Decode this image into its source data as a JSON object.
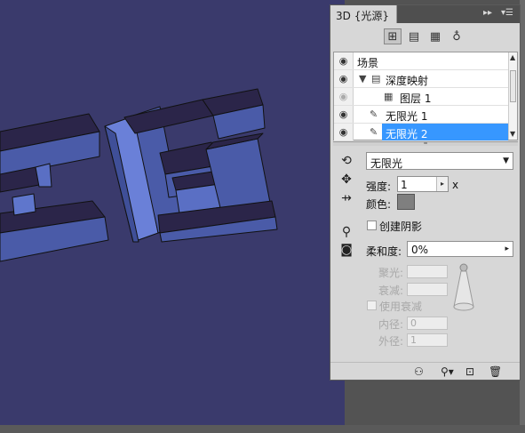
{
  "panel": {
    "tab_title": "3D {光源}",
    "expand_icon": "double-arrow-right-icon",
    "menu_icon": "panel-menu-icon"
  },
  "filters": {
    "icons": [
      "scene-filter-icon",
      "mesh-filter-icon",
      "material-filter-icon",
      "light-filter-icon"
    ]
  },
  "scene": {
    "rows": [
      {
        "label": "场景",
        "icon": "",
        "visible": true
      },
      {
        "label": "深度映射",
        "icon": "mesh-icon",
        "visible": true
      },
      {
        "label": "图层 1",
        "icon": "material-icon",
        "visible": false
      },
      {
        "label": "无限光 1",
        "icon": "infinite-light-icon",
        "visible": true
      },
      {
        "label": "无限光 2",
        "icon": "infinite-light-icon",
        "visible": true,
        "selected": true
      }
    ]
  },
  "properties": {
    "light_type": "无限光",
    "intensity_label": "强度:",
    "intensity_value": "1",
    "intensity_suffix": "x",
    "color_label": "颜色:",
    "color_value": "#7f7f7f",
    "shadow_label": "创建阴影",
    "softness_label": "柔和度:",
    "softness_value": "0%",
    "hotspot_label": "聚光:",
    "falloff_label": "衰减:",
    "use_attenuation_label": "使用衰减",
    "inner_label": "内径:",
    "inner_value": "0",
    "outer_label": "外径:",
    "outer_value": "1"
  },
  "canvas": {
    "background": "#3a3a6c",
    "text_art": "2165"
  }
}
